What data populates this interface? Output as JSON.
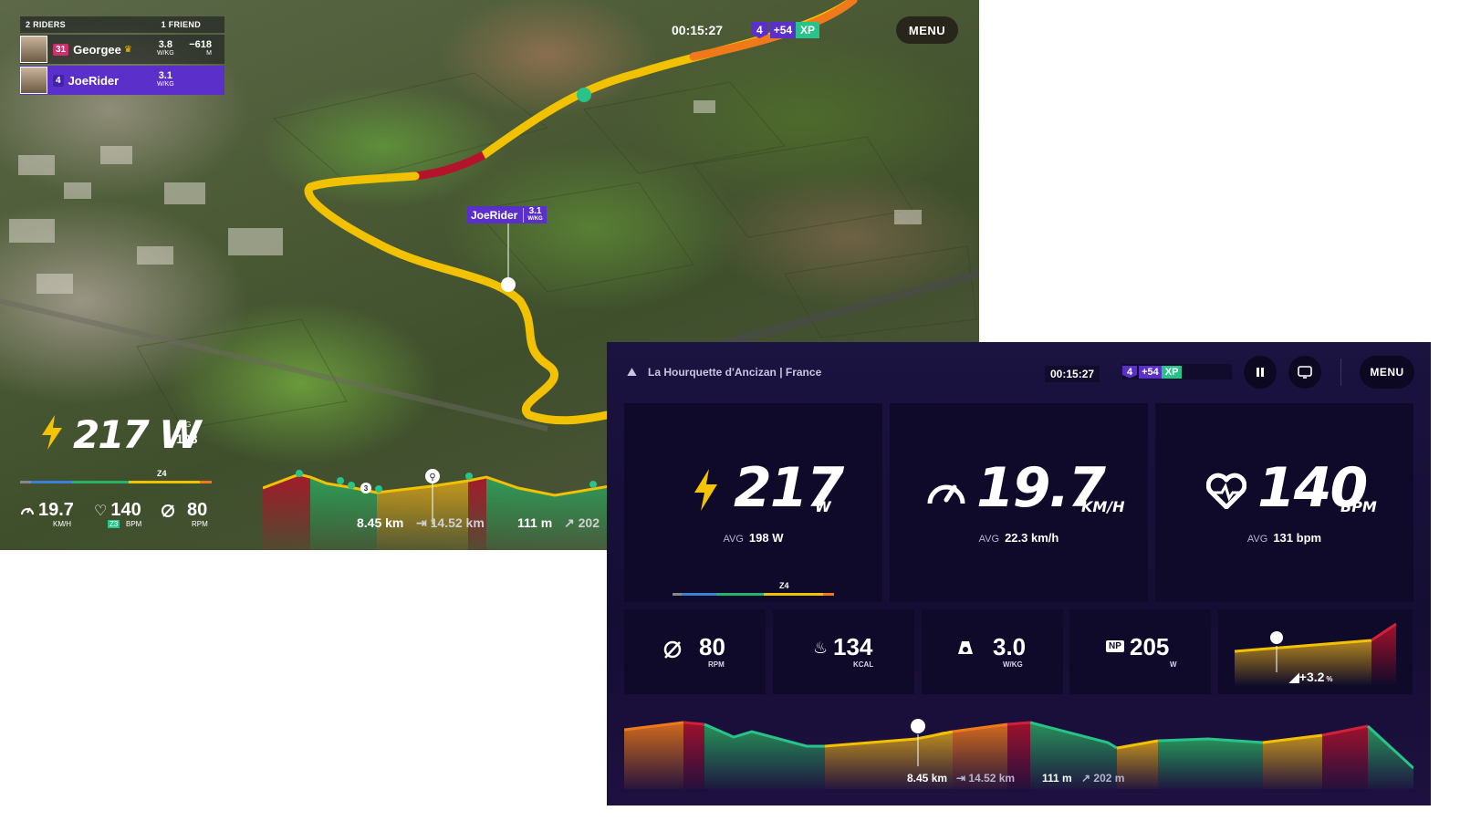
{
  "map_view": {
    "riders_header": {
      "count_label": "2 RIDERS",
      "friends_label": "1 FRIEND"
    },
    "riders": [
      {
        "level": "31",
        "name": "Georgee",
        "wkg": "3.8",
        "wkg_unit": "W/KG",
        "gap": "−618",
        "gap_unit": "M",
        "level_color": "#d0306a"
      },
      {
        "level": "4",
        "name": "JoeRider",
        "wkg": "3.1",
        "wkg_unit": "W/KG",
        "level_color": "#5b2fc9"
      }
    ],
    "timer": "00:15:27",
    "level_badge": "4",
    "xp_gain": "+54",
    "xp_label": "XP",
    "menu_label": "MENU",
    "rider_marker": {
      "name": "JoeRider",
      "wkg": "3.1",
      "wkg_unit": "W/KG"
    },
    "power": {
      "value": "217 W",
      "avg_label": "AVG",
      "avg_value": "198",
      "zone_label": "Z4"
    },
    "speed": {
      "value": "19.7",
      "unit": "KM/H"
    },
    "heart": {
      "value": "140",
      "zone": "Z3",
      "unit": "BPM"
    },
    "cadence": {
      "value": "80",
      "unit": "RPM"
    },
    "elevation_marker": "3",
    "distance": "8.45 km",
    "total_distance": "14.52 km",
    "climb": "111 m",
    "climb_total": "202"
  },
  "dashboard": {
    "route_name": "La Hourquette d'Ancizan | France",
    "timer": "00:15:27",
    "level_badge": "4",
    "xp_gain": "+54",
    "xp_label": "XP",
    "menu_label": "MENU",
    "power": {
      "value": "217",
      "unit": "W",
      "avg_label": "AVG",
      "avg_value": "198 W",
      "zone_label": "Z4"
    },
    "speed": {
      "value": "19.7",
      "unit": "KM/H",
      "avg_label": "AVG",
      "avg_value": "22.3 km/h"
    },
    "heart": {
      "value": "140",
      "unit": "BPM",
      "avg_label": "AVG",
      "avg_value": "131 bpm"
    },
    "cadence": {
      "value": "80",
      "unit": "RPM"
    },
    "calories": {
      "value": "134",
      "unit": "KCAL"
    },
    "wkg": {
      "value": "3.0",
      "unit": "W/KG"
    },
    "np": {
      "badge": "NP",
      "value": "205",
      "unit": "W"
    },
    "grade": {
      "value": "+3.2",
      "unit": "%"
    },
    "distance": "8.45 km",
    "total_distance": "14.52 km",
    "climb": "111 m",
    "climb_total": "202 m"
  },
  "colors": {
    "accent_purple": "#5b2fc9",
    "xp_green": "#27c38a",
    "route_yellow": "#f2c200",
    "route_red": "#b5122b",
    "route_orange": "#f07a1a",
    "bolt_yellow": "#f5c400"
  },
  "icons": [
    "bolt-icon",
    "speedometer-icon",
    "heart-icon",
    "cadence-icon",
    "flame-icon",
    "kettlebell-icon",
    "np-icon",
    "bike-marker-icon",
    "pause-icon",
    "cast-icon",
    "route-icon",
    "arrow-right-icon",
    "climb-icon"
  ]
}
